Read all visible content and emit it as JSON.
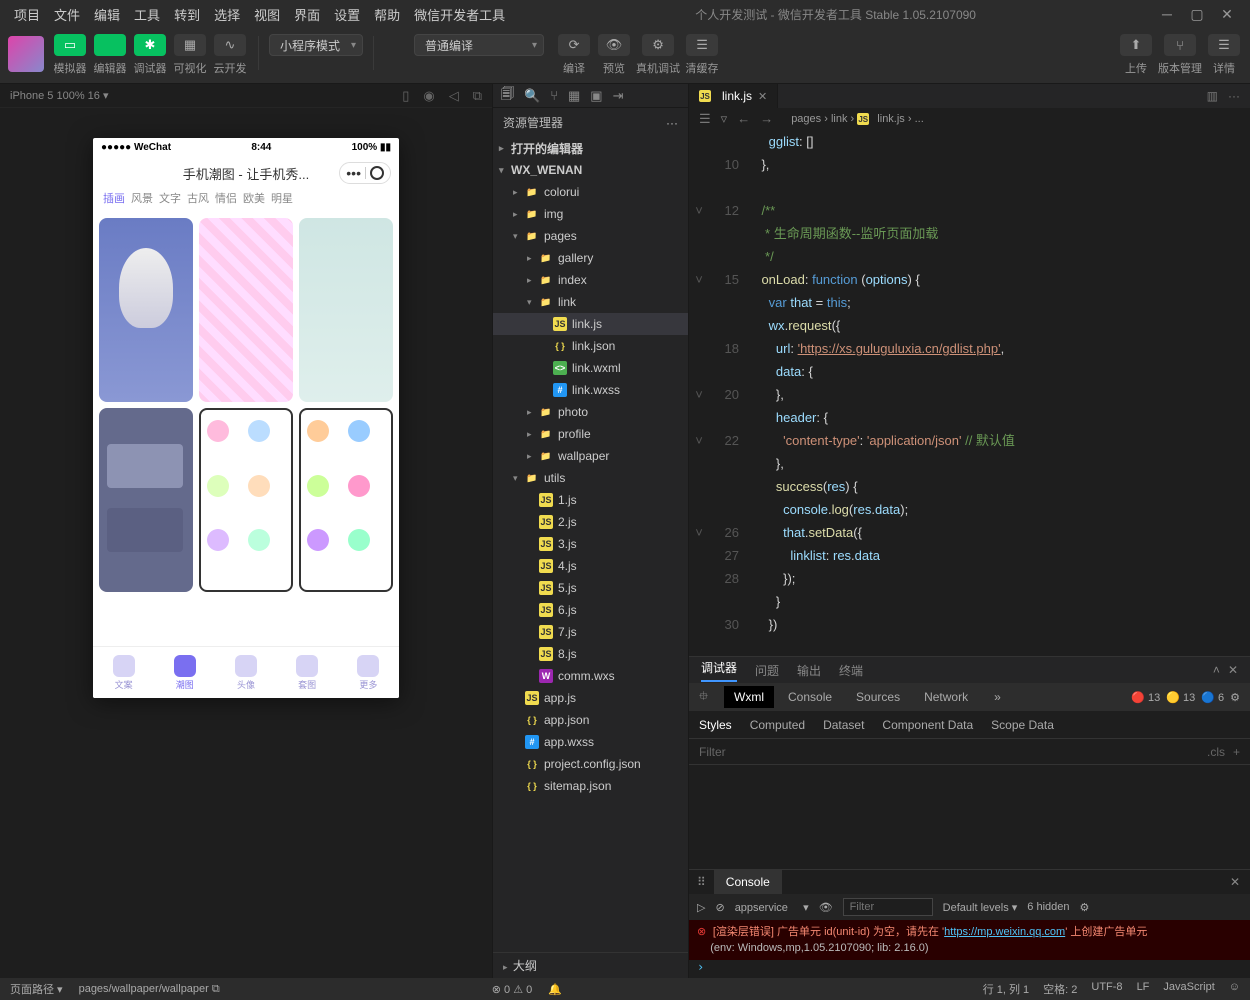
{
  "menu": [
    "项目",
    "文件",
    "编辑",
    "工具",
    "转到",
    "选择",
    "视图",
    "界面",
    "设置",
    "帮助",
    "微信开发者工具"
  ],
  "title": "个人开发测试 - 微信开发者工具 Stable 1.05.2107090",
  "toolbar": {
    "left": [
      {
        "id": "simulator",
        "label": "模拟器",
        "green": true
      },
      {
        "id": "editor",
        "label": "编辑器",
        "green": true
      },
      {
        "id": "debugger",
        "label": "调试器",
        "green": true
      },
      {
        "id": "visual",
        "label": "可视化",
        "green": false
      },
      {
        "id": "cloud",
        "label": "云开发",
        "green": false
      }
    ],
    "mode": "小程序模式",
    "compile": "普通编译",
    "mid": [
      {
        "id": "compile",
        "label": "编译"
      },
      {
        "id": "preview",
        "label": "预览"
      },
      {
        "id": "realdebug",
        "label": "真机调试"
      },
      {
        "id": "clearcache",
        "label": "清缓存"
      }
    ],
    "right": [
      {
        "id": "upload",
        "label": "上传"
      },
      {
        "id": "version",
        "label": "版本管理"
      },
      {
        "id": "detail",
        "label": "详情"
      }
    ]
  },
  "simulator": {
    "device": "iPhone 5 100% 16",
    "phone": {
      "statusLeft": "●●●●● WeChat ",
      "time": "8:44",
      "battery": "100%",
      "navTitle": "手机潮图 - 让手机秀...",
      "tabs": [
        "插画",
        "风景",
        "文字",
        "古风",
        "情侣",
        "欧美",
        "明星"
      ],
      "activeTab": 0,
      "bottom": [
        {
          "id": "wenan",
          "label": "文案"
        },
        {
          "id": "chaotu",
          "label": "潮图"
        },
        {
          "id": "touxiang",
          "label": "头像"
        },
        {
          "id": "taotu",
          "label": "套图"
        },
        {
          "id": "more",
          "label": "更多"
        }
      ],
      "bottomActive": 1
    }
  },
  "explorer": {
    "title": "资源管理器",
    "sections": {
      "opened": "打开的编辑器",
      "project": "WX_WENAN",
      "outline": "大纲"
    },
    "tree": [
      {
        "d": 1,
        "t": "folder",
        "n": "colorui",
        "c": true
      },
      {
        "d": 1,
        "t": "folder-g",
        "n": "img",
        "c": true
      },
      {
        "d": 1,
        "t": "folder-g",
        "n": "pages",
        "c": false
      },
      {
        "d": 2,
        "t": "folder",
        "n": "gallery",
        "c": true
      },
      {
        "d": 2,
        "t": "folder",
        "n": "index",
        "c": true
      },
      {
        "d": 2,
        "t": "folder",
        "n": "link",
        "c": false
      },
      {
        "d": 3,
        "t": "js",
        "n": "link.js",
        "sel": true
      },
      {
        "d": 3,
        "t": "json",
        "n": "link.json"
      },
      {
        "d": 3,
        "t": "wxml",
        "n": "link.wxml"
      },
      {
        "d": 3,
        "t": "wxss",
        "n": "link.wxss"
      },
      {
        "d": 2,
        "t": "folder",
        "n": "photo",
        "c": true
      },
      {
        "d": 2,
        "t": "folder",
        "n": "profile",
        "c": true
      },
      {
        "d": 2,
        "t": "folder",
        "n": "wallpaper",
        "c": true
      },
      {
        "d": 1,
        "t": "folder-g",
        "n": "utils",
        "c": false
      },
      {
        "d": 2,
        "t": "js",
        "n": "1.js"
      },
      {
        "d": 2,
        "t": "js",
        "n": "2.js"
      },
      {
        "d": 2,
        "t": "js",
        "n": "3.js"
      },
      {
        "d": 2,
        "t": "js",
        "n": "4.js"
      },
      {
        "d": 2,
        "t": "js",
        "n": "5.js"
      },
      {
        "d": 2,
        "t": "js",
        "n": "6.js"
      },
      {
        "d": 2,
        "t": "js",
        "n": "7.js"
      },
      {
        "d": 2,
        "t": "js",
        "n": "8.js"
      },
      {
        "d": 2,
        "t": "wxs",
        "n": "comm.wxs"
      },
      {
        "d": 1,
        "t": "js",
        "n": "app.js"
      },
      {
        "d": 1,
        "t": "json",
        "n": "app.json"
      },
      {
        "d": 1,
        "t": "wxss",
        "n": "app.wxss"
      },
      {
        "d": 1,
        "t": "json",
        "n": "project.config.json"
      },
      {
        "d": 1,
        "t": "json",
        "n": "sitemap.json"
      }
    ]
  },
  "editor": {
    "tab": "link.js",
    "breadcrumb": [
      "pages",
      "link",
      "link.js",
      "..."
    ],
    "lines": [
      {
        "n": "",
        "html": "      <span class='c-prop'>gglist</span>: []"
      },
      {
        "n": "10",
        "html": "    },"
      },
      {
        "n": "",
        "html": ""
      },
      {
        "n": "12",
        "html": "    <span class='c-cmt'>/**</span>"
      },
      {
        "n": "",
        "html": "<span class='c-cmt'>     * 生命周期函数--监听页面加载</span>"
      },
      {
        "n": "",
        "html": "<span class='c-cmt'>     */</span>"
      },
      {
        "n": "15",
        "html": "    <span class='c-fn'>onLoad</span>: <span class='c-key'>function</span> (<span class='c-prop'>options</span>) {"
      },
      {
        "n": "",
        "html": "      <span class='c-key'>var</span> <span class='c-prop'>that</span> = <span class='c-this'>this</span>;"
      },
      {
        "n": "",
        "html": "      <span class='c-prop'>wx</span>.<span class='c-fn'>request</span>({"
      },
      {
        "n": "18",
        "html": "        <span class='c-prop'>url</span>: <span class='c-str url-u'>'https://xs.guluguluxia.cn/gdlist.php'</span>,"
      },
      {
        "n": "",
        "html": "        <span class='c-prop'>data</span>: {"
      },
      {
        "n": "20",
        "html": "        },"
      },
      {
        "n": "",
        "html": "        <span class='c-prop'>header</span>: {"
      },
      {
        "n": "22",
        "html": "          <span class='c-str'>'content-type'</span>: <span class='c-str'>'application/json'</span> <span class='c-cmt'>// 默认值</span>"
      },
      {
        "n": "",
        "html": "        },"
      },
      {
        "n": "",
        "html": "        <span class='c-fn'>success</span>(<span class='c-prop'>res</span>) {"
      },
      {
        "n": "",
        "html": "          <span class='c-prop'>console</span>.<span class='c-fn'>log</span>(<span class='c-prop'>res</span>.<span class='c-prop'>data</span>);"
      },
      {
        "n": "26",
        "html": "          <span class='c-prop'>that</span>.<span class='c-fn'>setData</span>({"
      },
      {
        "n": "27",
        "html": "            <span class='c-prop'>linklist</span>: <span class='c-prop'>res</span>.<span class='c-prop'>data</span>"
      },
      {
        "n": "28",
        "html": "          });"
      },
      {
        "n": "",
        "html": "        }"
      },
      {
        "n": "30",
        "html": "      })"
      }
    ]
  },
  "panel": {
    "topTabs": [
      "调试器",
      "问题",
      "输出",
      "终端"
    ],
    "inspTabs": [
      "Wxml",
      "Console",
      "Sources",
      "Network"
    ],
    "counts": {
      "err": "13",
      "warn": "13",
      "info": "6"
    },
    "styleTabs": [
      "Styles",
      "Computed",
      "Dataset",
      "Component Data",
      "Scope Data"
    ],
    "filter": "Filter",
    "cls": ".cls",
    "console": {
      "tab": "Console",
      "context": "appservice",
      "filter": "Filter",
      "levels": "Default levels",
      "hidden": "6 hidden",
      "msg1": "[渲染层错误] 广告单元 id(unit-id) 为空，请先在 '",
      "url": "https://mp.weixin.qq.com",
      "msg2": "' 上创建广告单元",
      "env": "(env: Windows,mp,1.05.2107090; lib: 2.16.0)"
    }
  },
  "status": {
    "pathLabel": "页面路径",
    "path": "pages/wallpaper/wallpaper",
    "errs": "0",
    "warns": "0",
    "line": "行 1, 列 1",
    "spaces": "空格: 2",
    "enc": "UTF-8",
    "eol": "LF",
    "lang": "JavaScript"
  }
}
